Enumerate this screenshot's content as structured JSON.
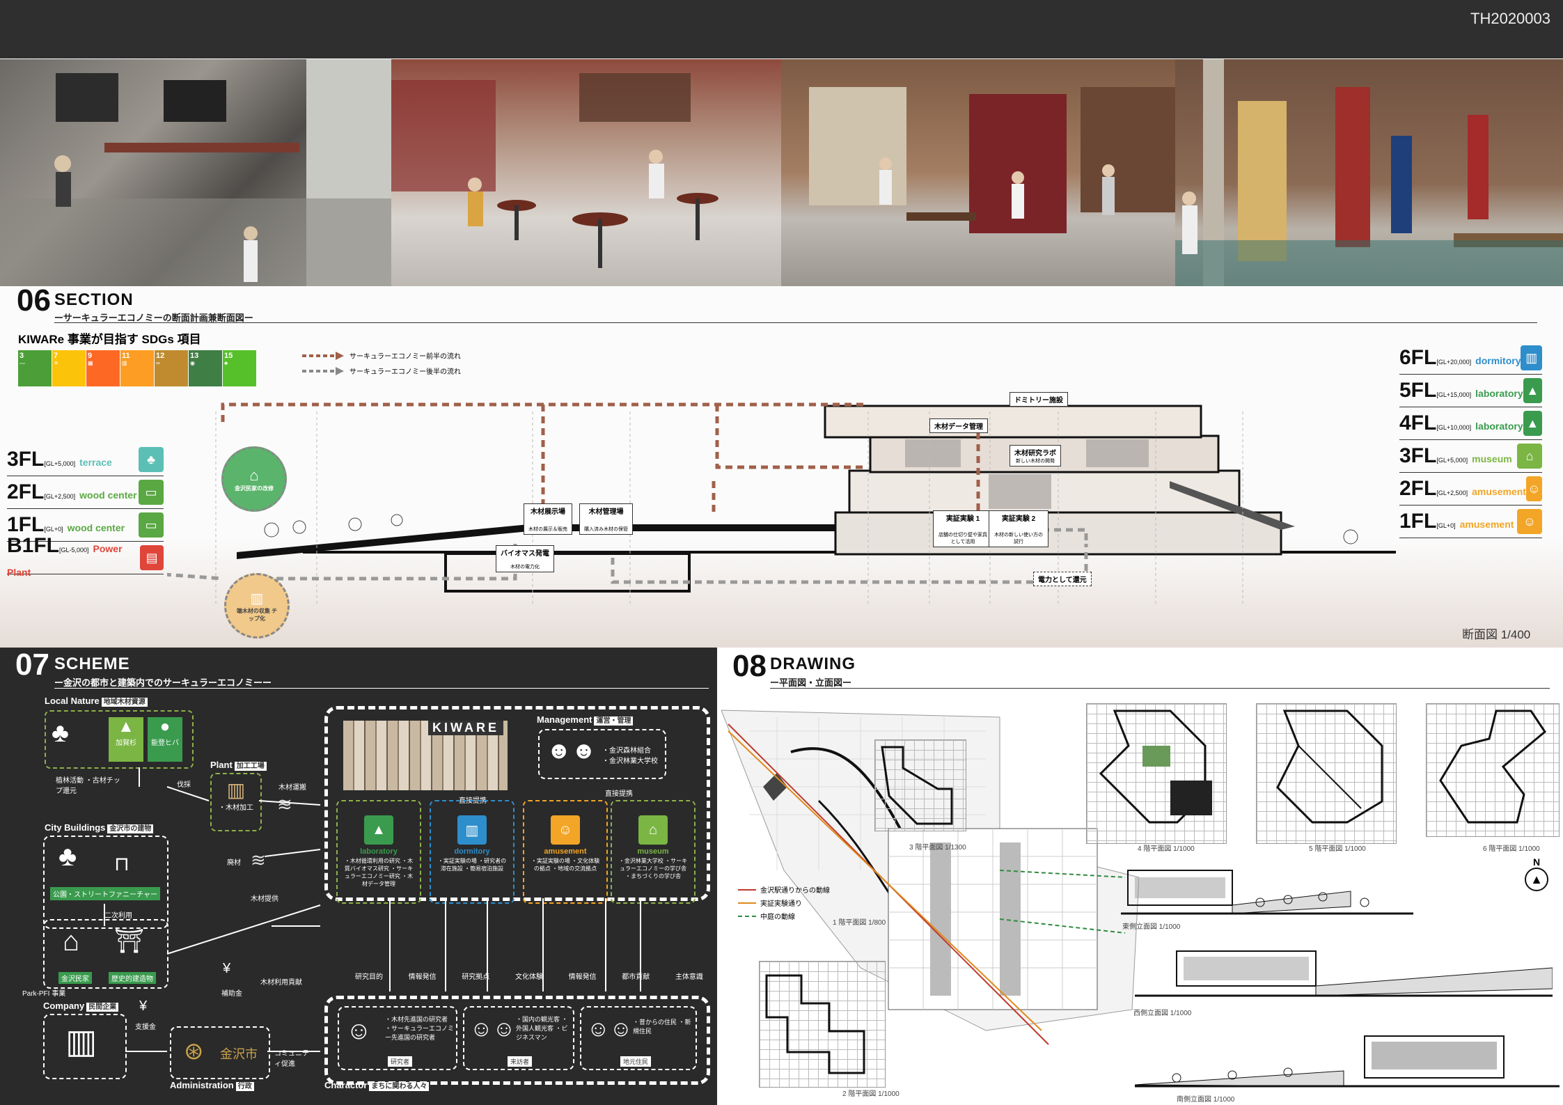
{
  "doc_id": "TH2020003",
  "section": {
    "num": "06",
    "title": "SECTION",
    "subtitle": "ーサーキュラーエコノミーの断面計画兼断面図ー",
    "sdg_heading": "KIWARe 事業が目指す SDGs 項目",
    "sdgs": [
      {
        "num": "3",
        "color": "#4c9f38"
      },
      {
        "num": "7",
        "color": "#fcc30b"
      },
      {
        "num": "9",
        "color": "#fd6925"
      },
      {
        "num": "11",
        "color": "#fd9d24"
      },
      {
        "num": "12",
        "color": "#bf8b2e"
      },
      {
        "num": "13",
        "color": "#3f7e44"
      },
      {
        "num": "15",
        "color": "#56c02b"
      }
    ],
    "legend_front": "サーキュラーエコノミー前半の流れ",
    "legend_back": "サーキュラーエコノミー後半の流れ",
    "left_floors": [
      {
        "floor": "3FL",
        "gl": "[GL+5,000]",
        "use": "terrace",
        "color": "#5bbfb5"
      },
      {
        "floor": "2FL",
        "gl": "[GL+2,500]",
        "use": "wood center",
        "color": "#5aa843"
      },
      {
        "floor": "1FL",
        "gl": "[GL+0]",
        "use": "wood center",
        "color": "#5aa843"
      },
      {
        "floor": "B1FL",
        "gl": "[GL-5,000]",
        "use": "Power Plant",
        "color": "#e0453a"
      }
    ],
    "right_floors": [
      {
        "floor": "6FL",
        "gl": "[GL+20,000]",
        "use": "dormitory",
        "color": "#2e8ecb"
      },
      {
        "floor": "5FL",
        "gl": "[GL+15,000]",
        "use": "laboratory",
        "color": "#3a9b4e"
      },
      {
        "floor": "4FL",
        "gl": "[GL+10,000]",
        "use": "laboratory",
        "color": "#3a9b4e"
      },
      {
        "floor": "3FL",
        "gl": "[GL+5,000]",
        "use": "museum",
        "color": "#7bb544"
      },
      {
        "floor": "2FL",
        "gl": "[GL+2,500]",
        "use": "amusement",
        "color": "#f2a526"
      },
      {
        "floor": "1FL",
        "gl": "[GL+0]",
        "use": "amusement",
        "color": "#f2a526"
      }
    ],
    "circle_top": "金沢民家の改修",
    "circle_bottom": "端木材の収集 チップ化",
    "tags": {
      "dormitory": "ドミトリー施設",
      "data_mgmt": "木材データ管理",
      "research": "木材研究ラボ",
      "research_sub": "新しい木材の開発",
      "exhibit": "木材展示場",
      "exhibit_sub": "木材の展示＆販売",
      "storage": "木材管理場",
      "storage_sub": "購入済み木材の保管",
      "biomass": "バイオマス発電",
      "biomass_sub": "木材の電力化",
      "exp1": "実証実験 1",
      "exp1_sub": "店舗の仕切り壁や家具として活用",
      "exp2": "実証実験 2",
      "exp2_sub": "木材の新しい使い方の試行",
      "power": "電力として還元"
    },
    "scale": "断面図 1/400"
  },
  "scheme": {
    "num": "07",
    "title": "SCHEME",
    "subtitle": "ー金沢の都市と建築内でのサーキュラーエコノミーー",
    "local_nature": {
      "label": "Local Nature",
      "jp": "地域木材資源",
      "items": [
        "加賀杉",
        "能登ヒバ"
      ]
    },
    "logging": "植林活動 ・古材チップ還元",
    "plant": {
      "label": "Plant",
      "jp": "加工工場",
      "item": "・木材加工"
    },
    "cutting": "伐採",
    "transport": "木材運搬",
    "city": {
      "label": "City Buildings",
      "jp": "金沢市の建物",
      "furniture": "公園・ストリートファニーチャー",
      "secondary": "二次利用",
      "minka": "金沢民家",
      "historic": "歴史的建造物"
    },
    "waste": "廃材",
    "supply": "木材提供",
    "kiware": "KIWARE",
    "management": {
      "label": "Management",
      "jp": "運営・管理",
      "items": [
        "・金沢森林組合",
        "・金沢林業大学校"
      ]
    },
    "direct1": "直接提携",
    "direct2": "直接提携",
    "cards": [
      {
        "name": "laboratory",
        "color": "#3a9b4e",
        "desc": "・木材循環利用の研究 ・木質バイオマス研究 ・サーキュラーエコノミー研究 ・木材データ管理"
      },
      {
        "name": "dormitory",
        "color": "#2e8ecb",
        "desc": "・実証実験の場 ・研究者の滞在施設 ・簡易宿泊施設"
      },
      {
        "name": "amusement",
        "color": "#f2a526",
        "desc": "・実証実験の場 ・文化体験の拠点 ・地域の交流拠点"
      },
      {
        "name": "museum",
        "color": "#7bb544",
        "desc": "・金沢林業大学校 ・サーキュラーエコノミーの学び舎 ・まちづくりの学び舎"
      }
    ],
    "flow_labels": [
      "研究目的",
      "情報発信",
      "研究拠点",
      "文化体験",
      "情報発信",
      "都市貢献",
      "主体意識"
    ],
    "wood_contrib": "木材利用貢献",
    "subsidy": "補助金",
    "support": "支援金",
    "parkpfi": "Park-PFI 事業",
    "company": {
      "label": "Company",
      "jp": "民間企業"
    },
    "admin": {
      "label": "Administration",
      "jp": "行政",
      "city": "金沢市"
    },
    "community": "コミュニティ促進",
    "character": {
      "label": "Charactor",
      "jp": "まちに関わる人々"
    },
    "people": [
      {
        "role": "研究者",
        "desc": "・木材先進国の研究者 ・サーキュラーエコノミー先進国の研究者"
      },
      {
        "role": "来訪者",
        "desc": "・国内の観光客 ・外国人観光客 ・ビジネスマン"
      },
      {
        "role": "地元住民",
        "desc": "・昔からの住民 ・新規住民"
      }
    ]
  },
  "drawing": {
    "num": "08",
    "title": "DRAWING",
    "subtitle": "ー平面図・立面図ー",
    "legend": [
      {
        "label": "金沢駅通りからの動線",
        "color": "#c0392b"
      },
      {
        "label": "実証実験通り",
        "color": "#e08a1e"
      },
      {
        "label": "中庭の動線",
        "color": "#2e8b3e"
      }
    ],
    "captions": {
      "plan1": "1 階平面図 1/800",
      "plan2": "2 階平面図 1/1000",
      "plan3": "3 階平面図 1/1300",
      "plan4": "4 階平面図 1/1000",
      "plan5": "5 階平面図 1/1000",
      "plan6": "6 階平面図 1/1000",
      "east": "東側立面図 1/1000",
      "west": "西側立面図 1/1000",
      "south": "南側立面図 1/1000"
    },
    "north": "N"
  }
}
